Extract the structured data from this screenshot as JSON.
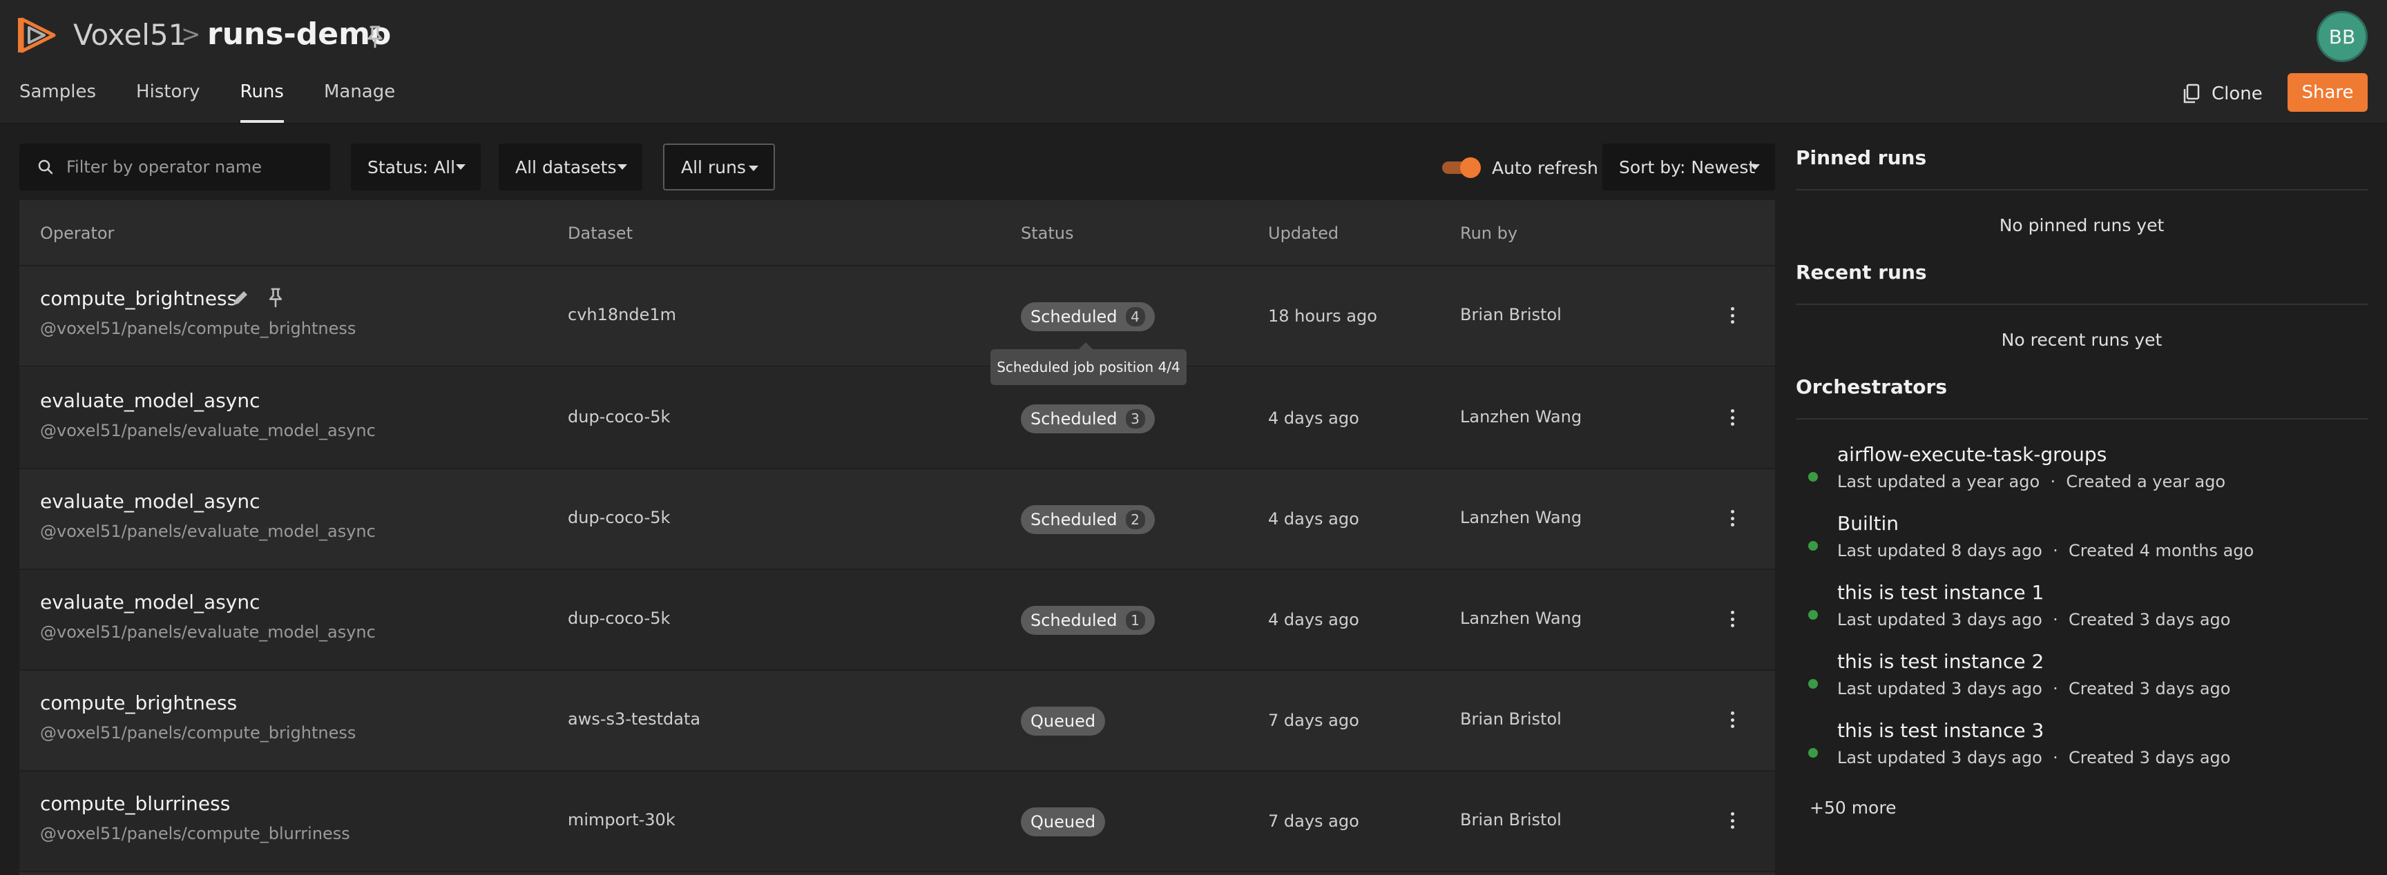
{
  "header": {
    "brand": "Voxel51",
    "separator": ">",
    "dataset_name": "runs-demo",
    "avatar_initials": "BB",
    "clone_label": "Clone",
    "share_label": "Share"
  },
  "tabs": [
    {
      "label": "Samples",
      "active": false
    },
    {
      "label": "History",
      "active": false
    },
    {
      "label": "Runs",
      "active": true
    },
    {
      "label": "Manage",
      "active": false
    }
  ],
  "filters": {
    "search_placeholder": "Filter by operator name",
    "status_label": "Status: All",
    "datasets_label": "All datasets",
    "runs_label": "All runs",
    "auto_refresh_label": "Auto refresh",
    "auto_refresh_on": true,
    "sort_label": "Sort by: Newest"
  },
  "table": {
    "columns": [
      "Operator",
      "Dataset",
      "Status",
      "Updated",
      "Run by"
    ],
    "rows": [
      {
        "operator": "compute_brightness",
        "path": "@voxel51/panels/compute_brightness",
        "dataset": "cvh18nde1m",
        "status": "Scheduled",
        "position": "4",
        "updated": "18 hours ago",
        "run_by": "Brian Bristol"
      },
      {
        "operator": "evaluate_model_async",
        "path": "@voxel51/panels/evaluate_model_async",
        "dataset": "dup-coco-5k",
        "status": "Scheduled",
        "position": "3",
        "updated": "4 days ago",
        "run_by": "Lanzhen Wang"
      },
      {
        "operator": "evaluate_model_async",
        "path": "@voxel51/panels/evaluate_model_async",
        "dataset": "dup-coco-5k",
        "status": "Scheduled",
        "position": "2",
        "updated": "4 days ago",
        "run_by": "Lanzhen Wang"
      },
      {
        "operator": "evaluate_model_async",
        "path": "@voxel51/panels/evaluate_model_async",
        "dataset": "dup-coco-5k",
        "status": "Scheduled",
        "position": "1",
        "updated": "4 days ago",
        "run_by": "Lanzhen Wang"
      },
      {
        "operator": "compute_brightness",
        "path": "@voxel51/panels/compute_brightness",
        "dataset": "aws-s3-testdata",
        "status": "Queued",
        "position": "",
        "updated": "7 days ago",
        "run_by": "Brian Bristol"
      },
      {
        "operator": "compute_blurriness",
        "path": "@voxel51/panels/compute_blurriness",
        "dataset": "mimport-30k",
        "status": "Queued",
        "position": "",
        "updated": "7 days ago",
        "run_by": "Brian Bristol"
      }
    ],
    "tooltip": "Scheduled job position 4/4"
  },
  "sidebar": {
    "pinned_title": "Pinned runs",
    "pinned_empty": "No pinned runs yet",
    "recent_title": "Recent runs",
    "recent_empty": "No recent runs yet",
    "orchestrators_title": "Orchestrators",
    "orchestrators": [
      {
        "name": "airflow-execute-task-groups",
        "updated": "Last updated a year ago",
        "created": "Created a year ago"
      },
      {
        "name": "Builtin",
        "updated": "Last updated 8 days ago",
        "created": "Created 4 months ago"
      },
      {
        "name": "this is test instance 1",
        "updated": "Last updated 3 days ago",
        "created": "Created 3 days ago"
      },
      {
        "name": "this is test instance 2",
        "updated": "Last updated 3 days ago",
        "created": "Created 3 days ago"
      },
      {
        "name": "this is test instance 3",
        "updated": "Last updated 3 days ago",
        "created": "Created 3 days ago"
      }
    ],
    "more_label": "+50 more",
    "meta_separator": "·"
  },
  "colors": {
    "accent": "#ef7a32",
    "avatar": "#3e9a7e",
    "status_dot": "#3a9a45"
  }
}
